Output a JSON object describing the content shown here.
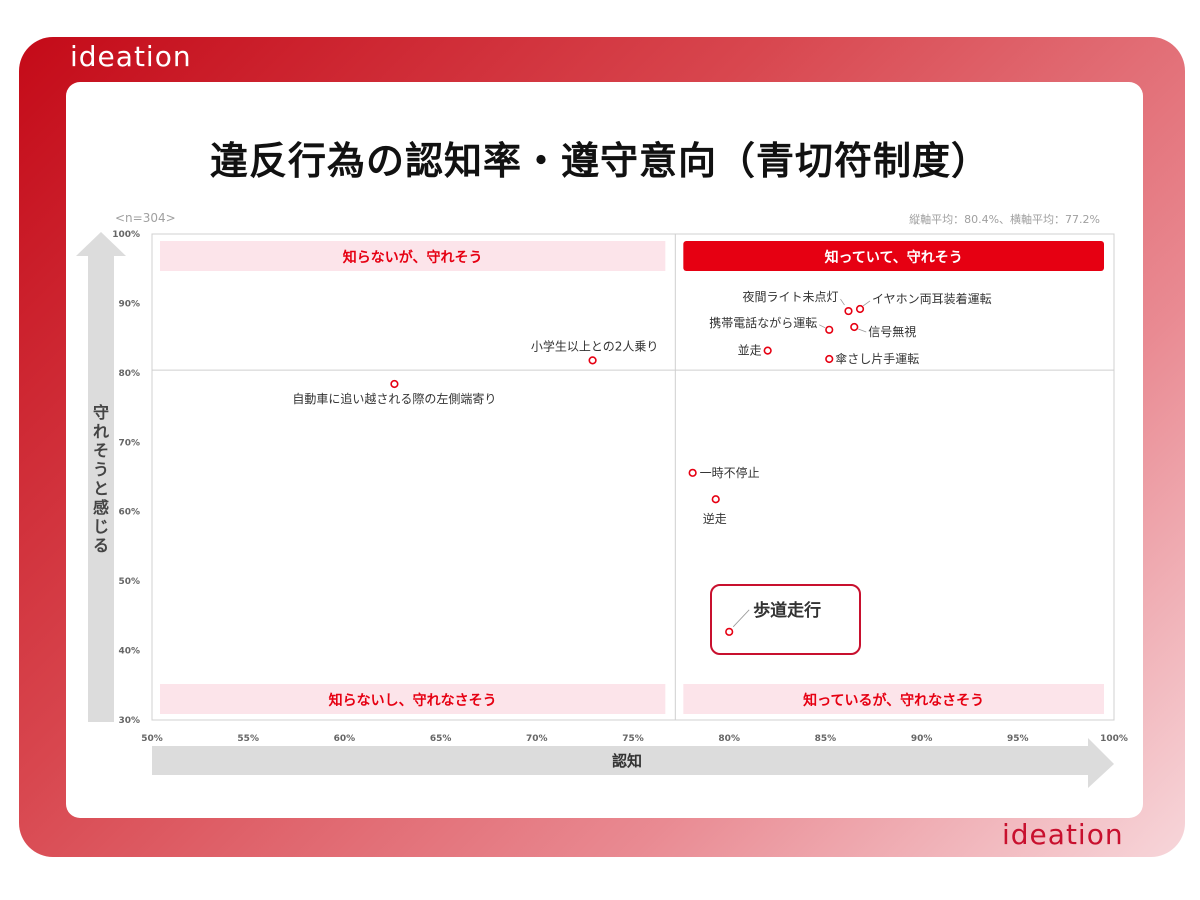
{
  "brand": {
    "logo_text": "ideation"
  },
  "title": "違反行為の認知率・遵守意向（青切符制度）",
  "sample_size": "<n=304>",
  "averages_note": "縦軸平均：80.4%、横軸平均：77.2%",
  "quadrants": {
    "top_left": "知らないが、守れそう",
    "top_right": "知っていて、守れそう",
    "bottom_left": "知らないし、守れなさそう",
    "bottom_right": "知っているが、守れなさそう"
  },
  "colors": {
    "accent": "#e60012",
    "quadrant_pale": "#fce4ea",
    "axis_arrow": "#dcdcdc",
    "callout_border": "#c8102e"
  },
  "chart_data": {
    "type": "scatter",
    "xlabel": "認知",
    "ylabel": "守れそうと感じる",
    "xlim": [
      50,
      100
    ],
    "ylim": [
      30,
      100
    ],
    "x_ticks": [
      "50%",
      "55%",
      "60%",
      "65%",
      "70%",
      "75%",
      "80%",
      "85%",
      "90%",
      "95%",
      "100%"
    ],
    "y_ticks": [
      "30%",
      "40%",
      "50%",
      "60%",
      "70%",
      "80%",
      "90%",
      "100%"
    ],
    "x_average": 77.2,
    "y_average": 80.4,
    "points": [
      {
        "label": "夜間ライト未点灯",
        "x": 86.2,
        "y": 88.9
      },
      {
        "label": "イヤホン両耳装着運転",
        "x": 86.8,
        "y": 89.2
      },
      {
        "label": "携帯電話ながら運転",
        "x": 85.2,
        "y": 86.2
      },
      {
        "label": "信号無視",
        "x": 86.5,
        "y": 86.6
      },
      {
        "label": "並走",
        "x": 82.0,
        "y": 83.2
      },
      {
        "label": "傘さし片手運転",
        "x": 85.2,
        "y": 82.0
      },
      {
        "label": "小学生以上との2人乗り",
        "x": 72.9,
        "y": 81.8
      },
      {
        "label": "自動車に追い越される際の左側端寄り",
        "x": 62.6,
        "y": 78.4
      },
      {
        "label": "一時不停止",
        "x": 78.1,
        "y": 65.6
      },
      {
        "label": "逆走",
        "x": 79.3,
        "y": 61.8
      },
      {
        "label": "歩道走行",
        "x": 80.0,
        "y": 42.7
      }
    ],
    "highlight": "歩道走行"
  }
}
